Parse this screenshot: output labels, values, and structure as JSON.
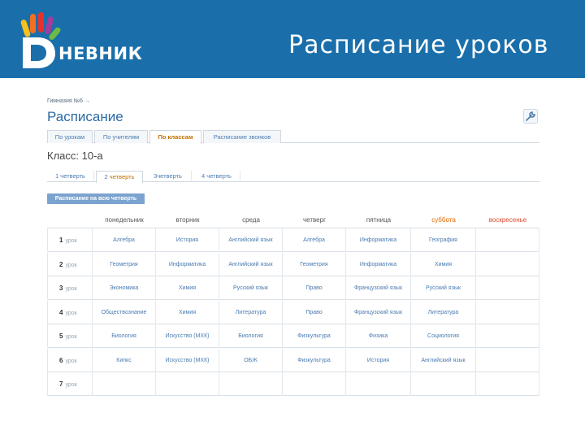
{
  "header": {
    "logo_text": "НЕВНИК",
    "title": "Расписание уроков"
  },
  "colors": {
    "header_bg": "#1a6fab",
    "link": "#4a7bb0",
    "active_tab": "#c07000",
    "saturday": "#e56a00",
    "sunday": "#e04a2a"
  },
  "breadcrumb": "Гимназия №6 →",
  "page_title": "Расписание",
  "tabs": [
    {
      "label": "По урокам"
    },
    {
      "label": "По учителям"
    },
    {
      "label": "По классам"
    },
    {
      "label": "Расписание звонков"
    }
  ],
  "class_title": "Класс: 10-а",
  "quarter_tabs": [
    {
      "num": "1",
      "label": "четверть"
    },
    {
      "num": "2",
      "label": "четверть"
    },
    {
      "num": "3",
      "label": "четверть"
    },
    {
      "num": "4",
      "label": "четверть"
    }
  ],
  "whole_quarter_button": "Расписание на всю четверть",
  "days": [
    "понедельник",
    "вторник",
    "среда",
    "четверг",
    "пятница",
    "суббота",
    "воскресенье"
  ],
  "lesson_word": "урок",
  "rows": [
    {
      "n": "1",
      "cells": [
        "Алгебра",
        "История",
        "Английский язык",
        "Алгебра",
        "Информатика",
        "География",
        ""
      ]
    },
    {
      "n": "2",
      "cells": [
        "Геометрия",
        "Информатика",
        "Английский язык",
        "Геометрия",
        "Информатика",
        "Химия",
        ""
      ]
    },
    {
      "n": "3",
      "cells": [
        "Экономика",
        "Химия",
        "Русский язык",
        "Право",
        "Французский язык",
        "Русский язык",
        ""
      ]
    },
    {
      "n": "4",
      "cells": [
        "Обществознание",
        "Химия",
        "Литература",
        "Право",
        "Французский язык",
        "Литература",
        ""
      ]
    },
    {
      "n": "5",
      "cells": [
        "Биология",
        "Искусство (МХК)",
        "Биология",
        "Физкультура",
        "Физика",
        "Социология",
        ""
      ]
    },
    {
      "n": "6",
      "cells": [
        "Кипкс",
        "Искусство (МХК)",
        "ОБЖ",
        "Физкультура",
        "История",
        "Английский язык",
        ""
      ]
    },
    {
      "n": "7",
      "cells": [
        "",
        "",
        "",
        "",
        "",
        "",
        ""
      ]
    }
  ]
}
